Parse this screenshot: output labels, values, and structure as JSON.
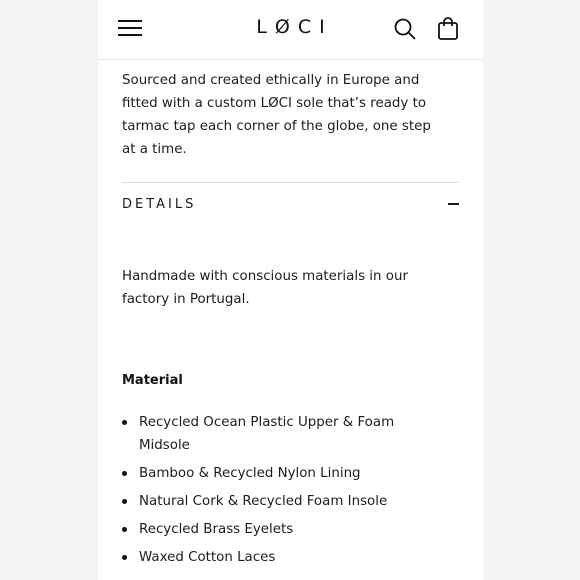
{
  "header": {
    "logo": "LØCI",
    "menu_icon": "hamburger-menu-icon",
    "search_icon": "search-icon",
    "bag_icon": "shopping-bag-icon"
  },
  "description": {
    "text": "Sourced and created ethically in Europe and fitted with a custom LØCI sole that’s ready to tarmac tap each corner of the globe, one step at a time."
  },
  "details": {
    "label": "DETAILS",
    "toggle_icon": "minus-icon",
    "text": "Handmade with conscious materials in our factory in Portugal.",
    "material_heading": "Material",
    "materials": [
      "Recycled Ocean Plastic Upper & Foam Midsole",
      "Bamboo & Recycled Nylon Lining",
      "Natural Cork & Recycled Foam Insole",
      "Recycled Brass Eyelets",
      "Waxed Cotton Laces"
    ]
  }
}
